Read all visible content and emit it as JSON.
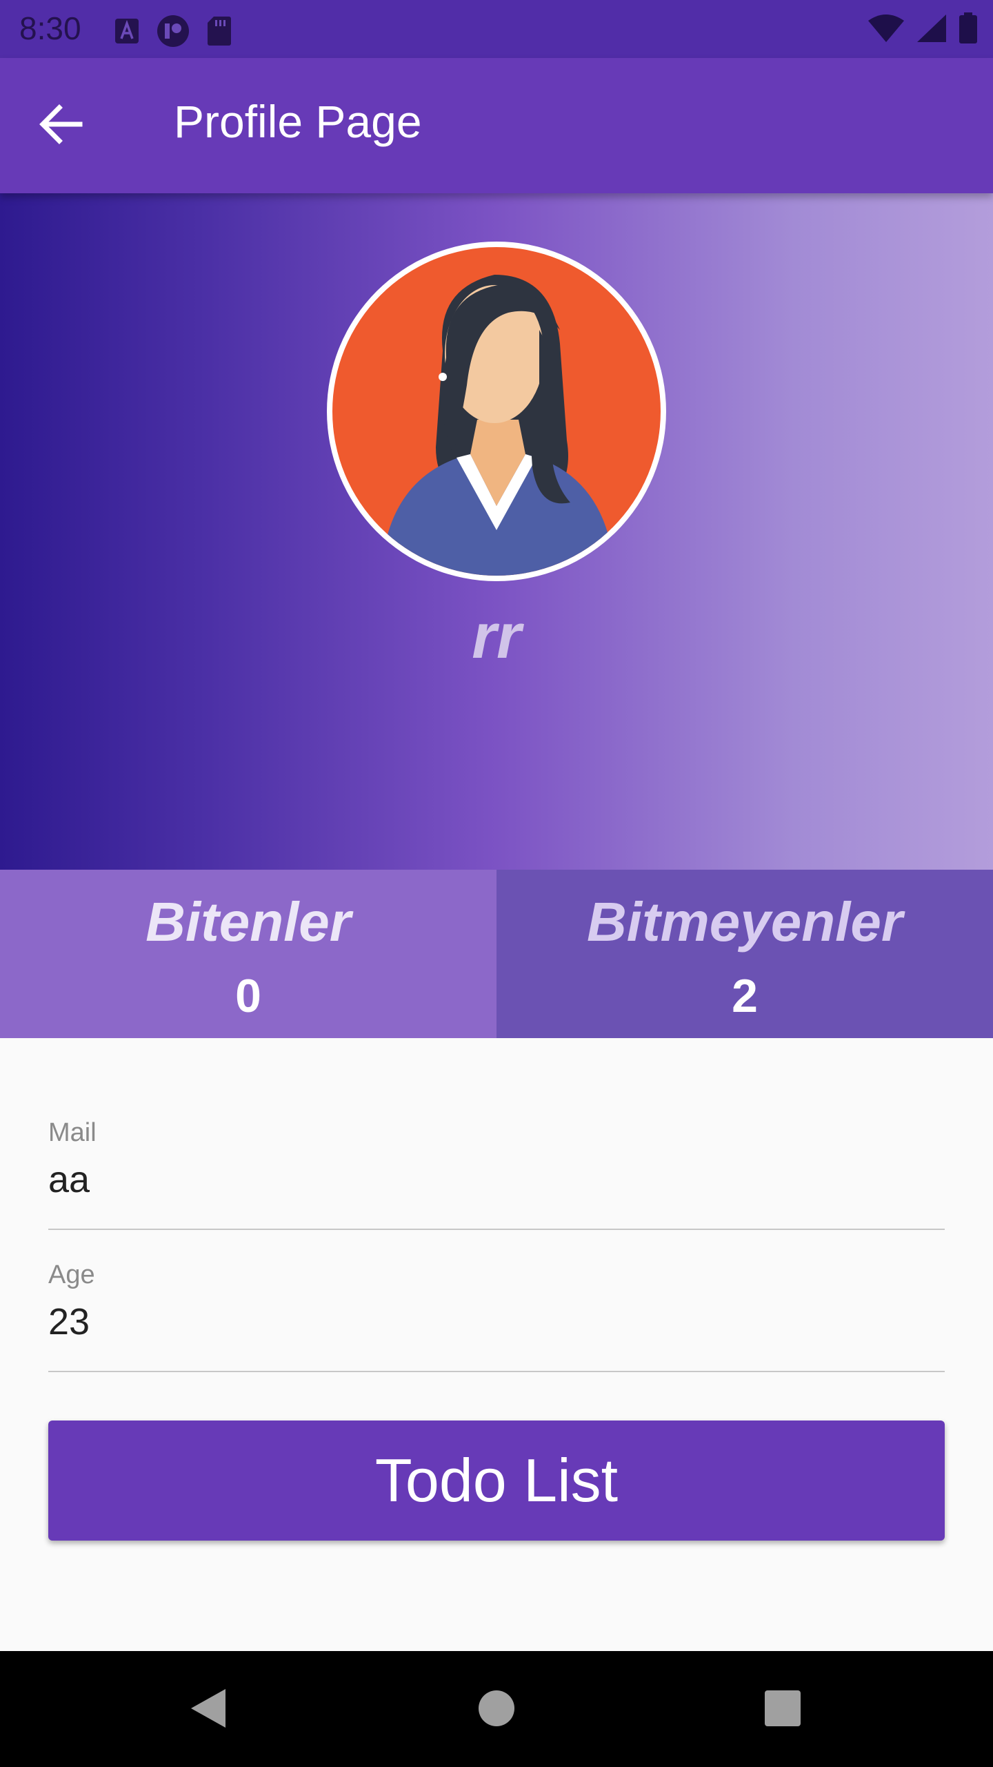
{
  "status_bar": {
    "time": "8:30",
    "icons_left": [
      "font-notification-icon",
      "app-notification-icon",
      "sd-card-icon"
    ],
    "icons_right": [
      "wifi-icon",
      "cellular-signal-icon",
      "battery-icon"
    ]
  },
  "app_bar": {
    "title": "Profile Page",
    "back_icon": "arrow-back-icon"
  },
  "profile": {
    "name": "rr",
    "avatar": "woman-avatar"
  },
  "stats": {
    "done_label": "Bitenler",
    "done_count": "0",
    "undone_label": "Bitmeyenler",
    "undone_count": "2"
  },
  "fields": {
    "mail_label": "Mail",
    "mail_value": "aa",
    "age_label": "Age",
    "age_value": "23"
  },
  "actions": {
    "todo_button_label": "Todo List"
  },
  "nav_bar": {
    "icons": [
      "back-triangle-icon",
      "home-circle-icon",
      "recents-square-icon"
    ]
  },
  "colors": {
    "primary": "#673ab7",
    "status_bar": "#512da8",
    "stat_done_bg": "#8c68c9",
    "stat_undone_bg": "#6b52b3"
  }
}
